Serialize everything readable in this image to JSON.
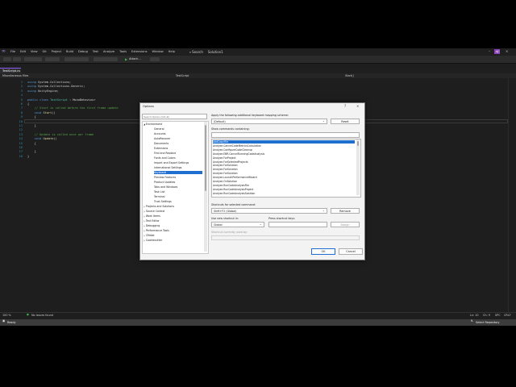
{
  "menubar": {
    "items": [
      "File",
      "Edit",
      "View",
      "Git",
      "Project",
      "Build",
      "Debug",
      "Test",
      "Analyze",
      "Tools",
      "Extensions",
      "Window",
      "Help"
    ],
    "search": "Search",
    "solution": "Solution1",
    "avatar": "JW"
  },
  "toolbar": {
    "attach": "Attach..."
  },
  "tabs": {
    "active": "TestScript.cs"
  },
  "breadcrumbs": {
    "project": "Miscellaneous Files",
    "class": "TestScript",
    "member": "Start()"
  },
  "editor": {
    "line_numbers": [
      "1",
      "2",
      "3",
      "4",
      "5",
      "6",
      "7",
      "8",
      "9",
      "10",
      "11",
      "12",
      "13",
      "14",
      "15",
      "16",
      "17",
      "18"
    ],
    "lines": [
      [
        [
          "kw",
          "using "
        ],
        [
          "pl",
          "System.Collections;"
        ]
      ],
      [
        [
          "kw",
          "using "
        ],
        [
          "pl",
          "System.Collections.Generic;"
        ]
      ],
      [
        [
          "kw",
          "using "
        ],
        [
          "pl",
          "UnityEngine;"
        ]
      ],
      [],
      [
        [
          "kw",
          "public class "
        ],
        [
          "ty",
          "TestScript"
        ],
        [
          "pl",
          " : MonoBehaviour"
        ]
      ],
      [
        [
          "pl",
          "{"
        ]
      ],
      [
        [
          "cm",
          "    // Start is called before the first frame update"
        ]
      ],
      [
        [
          "kw",
          "    void "
        ],
        [
          "fn",
          "Start"
        ],
        [
          "pl",
          "()"
        ]
      ],
      [
        [
          "pl",
          "    {"
        ]
      ],
      [],
      [
        [
          "pl",
          "    }"
        ]
      ],
      [],
      [
        [
          "cm",
          "    // Update is called once per frame"
        ]
      ],
      [
        [
          "kw",
          "    void "
        ],
        [
          "fn",
          "Update"
        ],
        [
          "pl",
          "()"
        ]
      ],
      [
        [
          "pl",
          "    {"
        ]
      ],
      [],
      [
        [
          "pl",
          "    }"
        ]
      ],
      [
        [
          "pl",
          "}"
        ]
      ]
    ]
  },
  "statusline": {
    "zoom": "100 %",
    "issues": "No issues found",
    "ln": "Ln: 10",
    "ch": "Ch: 9",
    "spc": "SPC",
    "crlf": "CRLF"
  },
  "statusbar": {
    "ready": "Ready",
    "repo": "Select Repository"
  },
  "dialog": {
    "title": "Options",
    "help": "?",
    "close": "×",
    "search_placeholder": "Search Options (Ctrl+E)",
    "tree": [
      {
        "label": "Environment",
        "level": 0,
        "expanded": true
      },
      {
        "label": "General",
        "level": 1
      },
      {
        "label": "Accounts",
        "level": 1
      },
      {
        "label": "AutoRecover",
        "level": 1
      },
      {
        "label": "Documents",
        "level": 1
      },
      {
        "label": "Extensions",
        "level": 1
      },
      {
        "label": "Find and Replace",
        "level": 1
      },
      {
        "label": "Fonts and Colors",
        "level": 1
      },
      {
        "label": "Import and Export Settings",
        "level": 1
      },
      {
        "label": "International Settings",
        "level": 1
      },
      {
        "label": "Keyboard",
        "level": 1,
        "selected": true
      },
      {
        "label": "Preview Features",
        "level": 1
      },
      {
        "label": "Product Updates",
        "level": 1
      },
      {
        "label": "Tabs and Windows",
        "level": 1
      },
      {
        "label": "Task List",
        "level": 1
      },
      {
        "label": "Terminal",
        "level": 1
      },
      {
        "label": "Trust Settings",
        "level": 1
      },
      {
        "label": "Projects and Solutions",
        "level": 0
      },
      {
        "label": "Source Control",
        "level": 0
      },
      {
        "label": "Work Items",
        "level": 0
      },
      {
        "label": "Text Editor",
        "level": 0
      },
      {
        "label": "Debugging",
        "level": 0
      },
      {
        "label": "Performance Tools",
        "level": 0
      },
      {
        "label": "CMake",
        "level": 0
      },
      {
        "label": "Cookiecutter",
        "level": 0
      }
    ],
    "mapping_label": "Apply the following additional keyboard mapping scheme:",
    "mapping_value": "(Default)",
    "reset": "Reset",
    "show_label": "Show commands containing:",
    "commands": [
      "AddCopyFile",
      "Analyze.CancelCodeMetricsCalculation",
      "Analyze.ConfigureCodeCleanup",
      "Analyze.EBR.CancelRunningCodeAnalysis",
      "Analyze.ForProject",
      "Analyze.ForSelectedProjects",
      "Analyze.ForSolution",
      "Analyze.ForSolution",
      "Analyze.ForSolution",
      "Analyze.LaunchPerformanceWizard",
      "Analyze.OnSolution",
      "Analyze.RunCodeAnalysisFile",
      "Analyze.RunCodeAnalysisProject",
      "Analyze.RunCodeAnalysisSolution"
    ],
    "shortcuts_label": "Shortcuts for selected command:",
    "shortcuts_value": "Shift+F2 (Global)",
    "remove": "Remove",
    "use_label": "Use new shortcut in:",
    "use_value": "Global",
    "press_label": "Press shortcut keys:",
    "assign": "Assign",
    "used_by_label": "Shortcut currently used by:",
    "ok": "OK",
    "cancel": "Cancel"
  },
  "colors": {
    "accent": "#1f6fd1",
    "ide_bg": "#1e1e1e",
    "dialog_bg": "#f3f3f3"
  }
}
